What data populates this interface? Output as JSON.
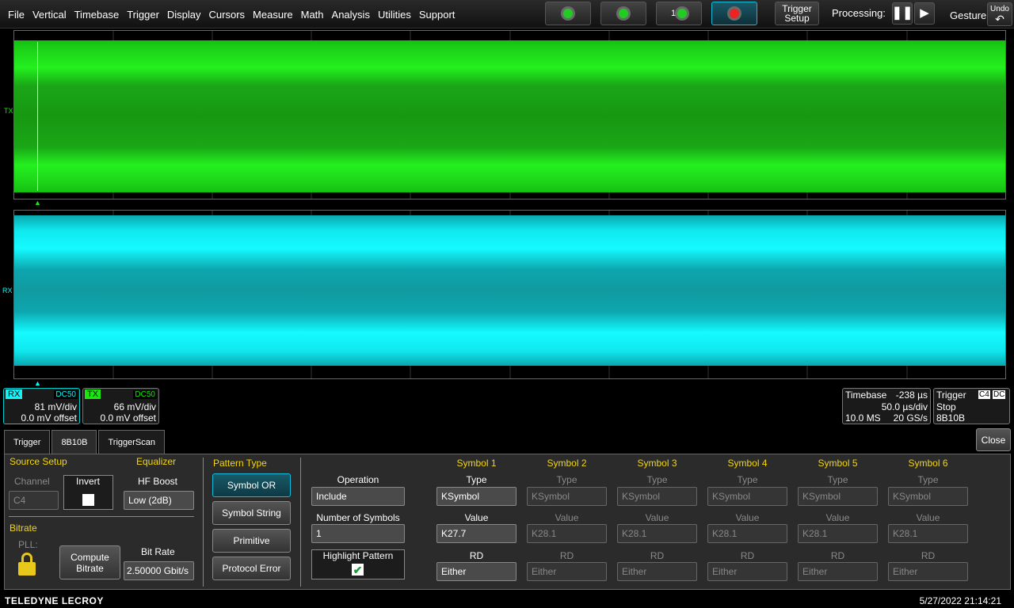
{
  "menu": [
    "File",
    "Vertical",
    "Timebase",
    "Trigger",
    "Display",
    "Cursors",
    "Measure",
    "Math",
    "Analysis",
    "Utilities",
    "Support"
  ],
  "toolbar": {
    "trigger_setup": "Trigger Setup",
    "processing": "Processing:",
    "gesture": "Gesture",
    "undo": "Undo",
    "btn3_label": "1"
  },
  "channels": {
    "tx": {
      "label": "TX",
      "coupling": "DC50",
      "scale": "66 mV/div",
      "offset": "0.0 mV offset",
      "color": "#19e80f"
    },
    "rx": {
      "label": "RX",
      "coupling": "DC50",
      "scale": "81 mV/div",
      "offset": "0.0 mV offset",
      "color": "#0ff4f8"
    }
  },
  "timebase": {
    "title": "Timebase",
    "delay": "-238 µs",
    "scale": "50.0 µs/div",
    "samples": "10.0 MS",
    "rate": "20 GS/s"
  },
  "trigger": {
    "title": "Trigger",
    "channel": "C4",
    "coupling": "DC",
    "mode": "Stop",
    "type": "8B10B"
  },
  "tabs": [
    "Trigger",
    "8B10B",
    "TriggerScan"
  ],
  "close": "Close",
  "source": {
    "title": "Source Setup",
    "channel_label": "Channel",
    "channel_value": "C4",
    "invert_label": "Invert",
    "equalizer": "Equalizer",
    "hf_boost_label": "HF Boost",
    "hf_boost_value": "Low (2dB)"
  },
  "bitrate": {
    "title": "Bitrate",
    "pll": "PLL:",
    "compute": "Compute Bitrate",
    "bitrate_label": "Bit Rate",
    "bitrate_value": "2.50000 Gbit/s"
  },
  "pattern": {
    "title": "Pattern Type",
    "options": [
      "Symbol OR",
      "Symbol String",
      "Primitive",
      "Protocol Error"
    ]
  },
  "operation": {
    "label": "Operation",
    "value": "Include",
    "num_label": "Number of Symbols",
    "num_value": "1",
    "highlight_label": "Highlight Pattern"
  },
  "symbols": [
    {
      "title": "Symbol 1",
      "type": "KSymbol",
      "value": "K27.7",
      "rd": "Either"
    },
    {
      "title": "Symbol 2",
      "type": "KSymbol",
      "value": "K28.1",
      "rd": "Either"
    },
    {
      "title": "Symbol 3",
      "type": "KSymbol",
      "value": "K28.1",
      "rd": "Either"
    },
    {
      "title": "Symbol 4",
      "type": "KSymbol",
      "value": "K28.1",
      "rd": "Either"
    },
    {
      "title": "Symbol 5",
      "type": "KSymbol",
      "value": "K28.1",
      "rd": "Either"
    },
    {
      "title": "Symbol 6",
      "type": "KSymbol",
      "value": "K28.1",
      "rd": "Either"
    }
  ],
  "field_labels": {
    "type": "Type",
    "value": "Value",
    "rd": "RD"
  },
  "footer": {
    "brand": "TELEDYNE LECROY",
    "datetime": "5/27/2022 21:14:21"
  }
}
